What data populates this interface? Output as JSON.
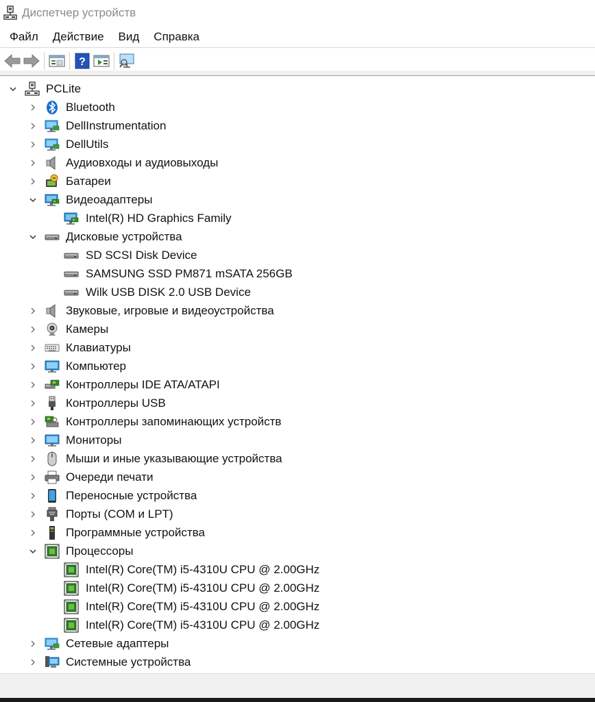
{
  "window": {
    "title": "Диспетчер устройств"
  },
  "menu": [
    "Файл",
    "Действие",
    "Вид",
    "Справка"
  ],
  "toolbar": {
    "buttons": [
      "back-arrow-icon",
      "forward-arrow-icon",
      "properties-icon",
      "help-icon",
      "run-icon",
      "monitor-scan-icon"
    ]
  },
  "tree": {
    "root": {
      "label": "PCLite",
      "expanded": true
    },
    "categories": [
      {
        "label": "Bluetooth",
        "icon": "bluetooth-icon",
        "expanded": false,
        "children": []
      },
      {
        "label": "DellInstrumentation",
        "icon": "network-monitor-icon",
        "expanded": false,
        "children": []
      },
      {
        "label": "DellUtils",
        "icon": "network-monitor-icon",
        "expanded": false,
        "children": []
      },
      {
        "label": "Аудиовходы и аудиовыходы",
        "icon": "speaker-icon",
        "expanded": false,
        "children": []
      },
      {
        "label": "Батареи",
        "icon": "battery-icon",
        "expanded": false,
        "children": []
      },
      {
        "label": "Видеоадаптеры",
        "icon": "display-adapter-icon",
        "expanded": true,
        "children": [
          "Intel(R) HD Graphics Family"
        ]
      },
      {
        "label": "Дисковые устройства",
        "icon": "disk-drive-icon",
        "expanded": true,
        "children": [
          "SD SCSI Disk Device",
          "SAMSUNG SSD PM871 mSATA 256GB",
          "Wilk USB DISK 2.0 USB Device"
        ]
      },
      {
        "label": "Звуковые, игровые и видеоустройства",
        "icon": "speaker-icon",
        "expanded": false,
        "children": []
      },
      {
        "label": "Камеры",
        "icon": "webcam-icon",
        "expanded": false,
        "children": []
      },
      {
        "label": "Клавиатуры",
        "icon": "keyboard-icon",
        "expanded": false,
        "children": []
      },
      {
        "label": "Компьютер",
        "icon": "computer-monitor-icon",
        "expanded": false,
        "children": []
      },
      {
        "label": "Контроллеры IDE ATA/ATAPI",
        "icon": "ide-controller-icon",
        "expanded": false,
        "children": []
      },
      {
        "label": "Контроллеры USB",
        "icon": "usb-plug-icon",
        "expanded": false,
        "children": []
      },
      {
        "label": "Контроллеры запоминающих устройств",
        "icon": "storage-controller-icon",
        "expanded": false,
        "children": []
      },
      {
        "label": "Мониторы",
        "icon": "computer-monitor-icon",
        "expanded": false,
        "children": []
      },
      {
        "label": "Мыши и иные указывающие устройства",
        "icon": "mouse-icon",
        "expanded": false,
        "children": []
      },
      {
        "label": "Очереди печати",
        "icon": "printer-icon",
        "expanded": false,
        "children": []
      },
      {
        "label": "Переносные устройства",
        "icon": "portable-device-icon",
        "expanded": false,
        "children": []
      },
      {
        "label": "Порты (COM и LPT)",
        "icon": "port-icon",
        "expanded": false,
        "children": []
      },
      {
        "label": "Программные устройства",
        "icon": "software-device-icon",
        "expanded": false,
        "children": []
      },
      {
        "label": "Процессоры",
        "icon": "processor-icon",
        "expanded": true,
        "children": [
          "Intel(R) Core(TM) i5-4310U CPU @ 2.00GHz",
          "Intel(R) Core(TM) i5-4310U CPU @ 2.00GHz",
          "Intel(R) Core(TM) i5-4310U CPU @ 2.00GHz",
          "Intel(R) Core(TM) i5-4310U CPU @ 2.00GHz"
        ]
      },
      {
        "label": "Сетевые адаптеры",
        "icon": "network-monitor-icon",
        "expanded": false,
        "children": []
      },
      {
        "label": "Системные устройства",
        "icon": "system-device-icon",
        "expanded": false,
        "children": []
      }
    ]
  }
}
